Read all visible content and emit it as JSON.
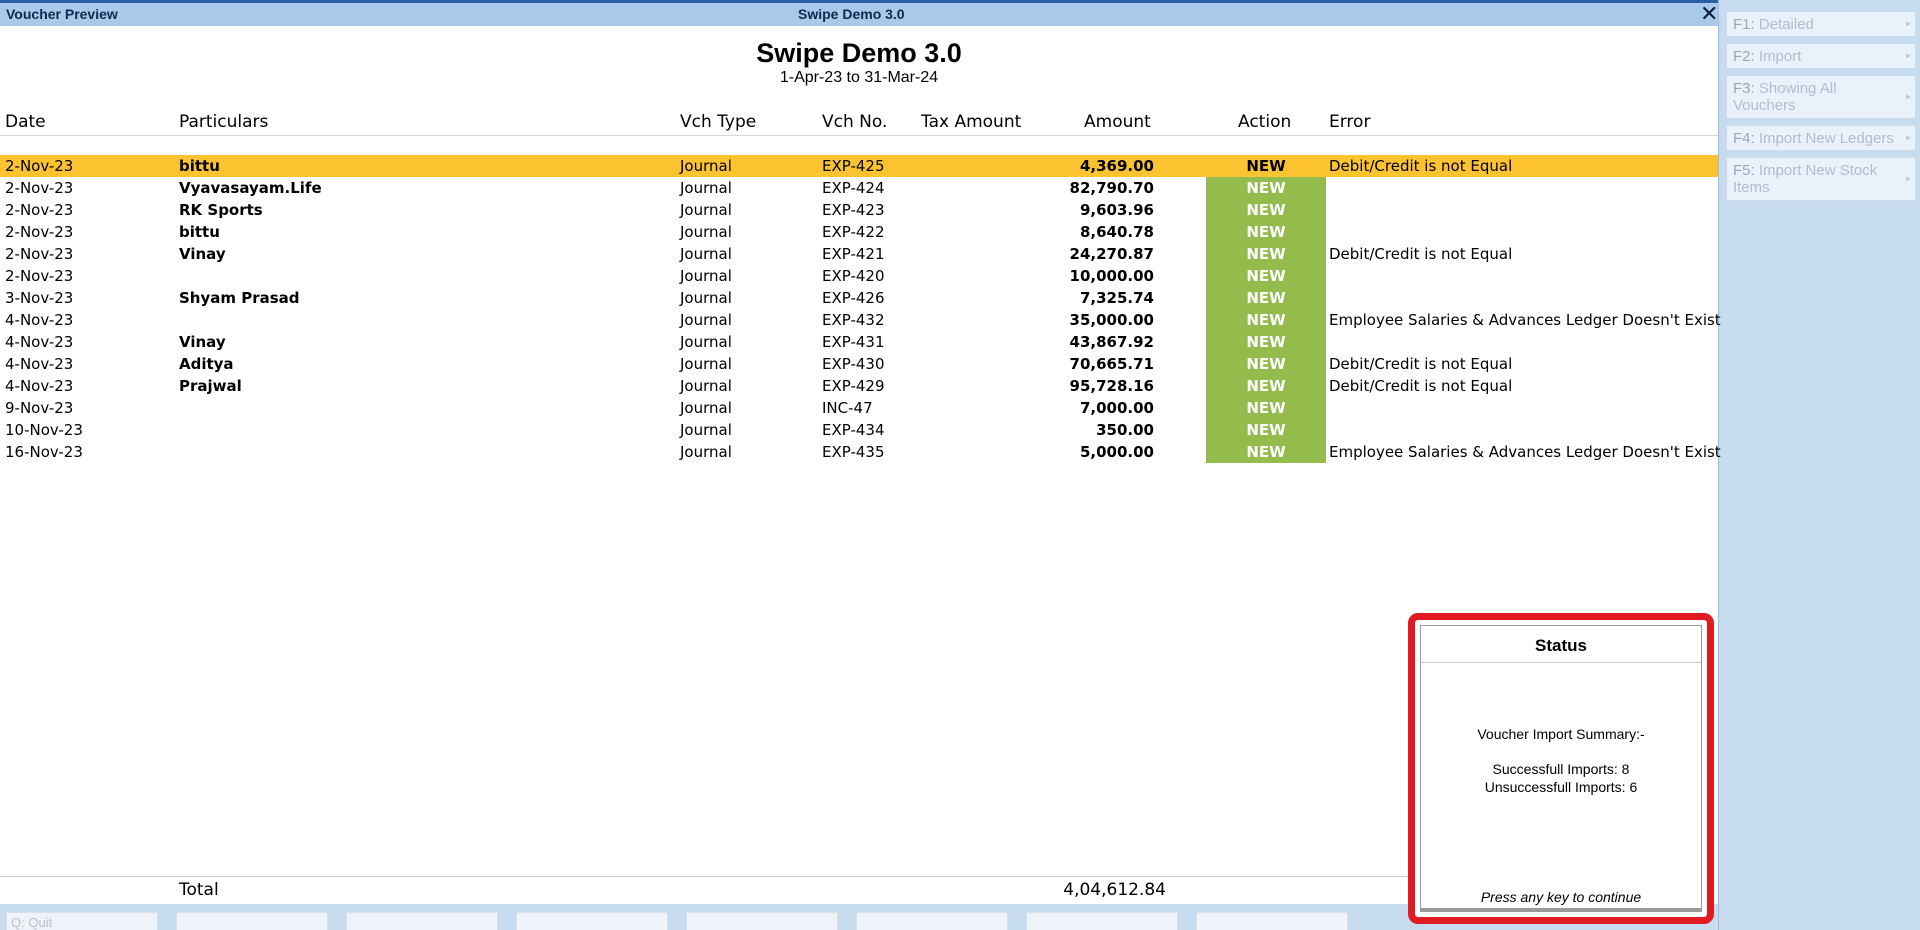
{
  "window": {
    "title": "Voucher Preview",
    "company_title": "Swipe Demo 3.0",
    "close_symbol": "✕"
  },
  "header": {
    "company": "Swipe Demo 3.0",
    "period": "1-Apr-23 to 31-Mar-24"
  },
  "columns": {
    "date": "Date",
    "particulars": "Particulars",
    "vch_type": "Vch Type",
    "vch_no": "Vch No.",
    "tax_amount": "Tax Amount",
    "amount": "Amount",
    "action": "Action",
    "error": "Error"
  },
  "rows": [
    {
      "date": "2-Nov-23",
      "particulars": "bittu",
      "vch_type": "Journal",
      "vch_no": "EXP-425",
      "amount": "4,369.00",
      "action": "NEW",
      "error": "Debit/Credit is not Equal",
      "selected": true
    },
    {
      "date": "2-Nov-23",
      "particulars": "Vyavasayam.Life",
      "vch_type": "Journal",
      "vch_no": "EXP-424",
      "amount": "82,790.70",
      "action": "NEW",
      "error": ""
    },
    {
      "date": "2-Nov-23",
      "particulars": "RK Sports",
      "vch_type": "Journal",
      "vch_no": "EXP-423",
      "amount": "9,603.96",
      "action": "NEW",
      "error": ""
    },
    {
      "date": "2-Nov-23",
      "particulars": "bittu",
      "vch_type": "Journal",
      "vch_no": "EXP-422",
      "amount": "8,640.78",
      "action": "NEW",
      "error": ""
    },
    {
      "date": "2-Nov-23",
      "particulars": "Vinay",
      "vch_type": "Journal",
      "vch_no": "EXP-421",
      "amount": "24,270.87",
      "action": "NEW",
      "error": "Debit/Credit is not Equal"
    },
    {
      "date": "2-Nov-23",
      "particulars": "",
      "vch_type": "Journal",
      "vch_no": "EXP-420",
      "amount": "10,000.00",
      "action": "NEW",
      "error": ""
    },
    {
      "date": "3-Nov-23",
      "particulars": "Shyam Prasad",
      "vch_type": "Journal",
      "vch_no": "EXP-426",
      "amount": "7,325.74",
      "action": "NEW",
      "error": ""
    },
    {
      "date": "4-Nov-23",
      "particulars": "",
      "vch_type": "Journal",
      "vch_no": "EXP-432",
      "amount": "35,000.00",
      "action": "NEW",
      "error": "Employee Salaries & Advances Ledger Doesn't Exist"
    },
    {
      "date": "4-Nov-23",
      "particulars": "Vinay",
      "vch_type": "Journal",
      "vch_no": "EXP-431",
      "amount": "43,867.92",
      "action": "NEW",
      "error": ""
    },
    {
      "date": "4-Nov-23",
      "particulars": "Aditya",
      "vch_type": "Journal",
      "vch_no": "EXP-430",
      "amount": "70,665.71",
      "action": "NEW",
      "error": "Debit/Credit is not Equal"
    },
    {
      "date": "4-Nov-23",
      "particulars": "Prajwal",
      "vch_type": "Journal",
      "vch_no": "EXP-429",
      "amount": "95,728.16",
      "action": "NEW",
      "error": "Debit/Credit is not Equal"
    },
    {
      "date": "9-Nov-23",
      "particulars": "",
      "vch_type": "Journal",
      "vch_no": "INC-47",
      "amount": "7,000.00",
      "action": "NEW",
      "error": ""
    },
    {
      "date": "10-Nov-23",
      "particulars": "",
      "vch_type": "Journal",
      "vch_no": "EXP-434",
      "amount": "350.00",
      "action": "NEW",
      "error": ""
    },
    {
      "date": "16-Nov-23",
      "particulars": "",
      "vch_type": "Journal",
      "vch_no": "EXP-435",
      "amount": "5,000.00",
      "action": "NEW",
      "error": "Employee Salaries & Advances Ledger Doesn't Exist"
    }
  ],
  "total": {
    "label": "Total",
    "amount": "4,04,612.84"
  },
  "right_panel": [
    {
      "key": "F1:",
      "label": "Detailed"
    },
    {
      "key": "F2:",
      "label": "Import"
    },
    {
      "key": "F3:",
      "label": "Showing All Vouchers"
    },
    {
      "key": "F4:",
      "label": "Import New Ledgers"
    },
    {
      "key": "F5:",
      "label": "Import New Stock Items"
    }
  ],
  "bottom_bar": {
    "quit": "Q: Quit"
  },
  "status": {
    "title": "Status",
    "summary": "Voucher Import Summary:-",
    "successful": "Successfull Imports: 8",
    "unsuccessful": "Unsuccessfull Imports: 6",
    "continue": "Press any key to continue"
  },
  "colors": {
    "selected_row": "#fcc331",
    "action_new": "#93bc4c",
    "status_border": "#e11b22",
    "title_bar": "#a9c9ea"
  }
}
